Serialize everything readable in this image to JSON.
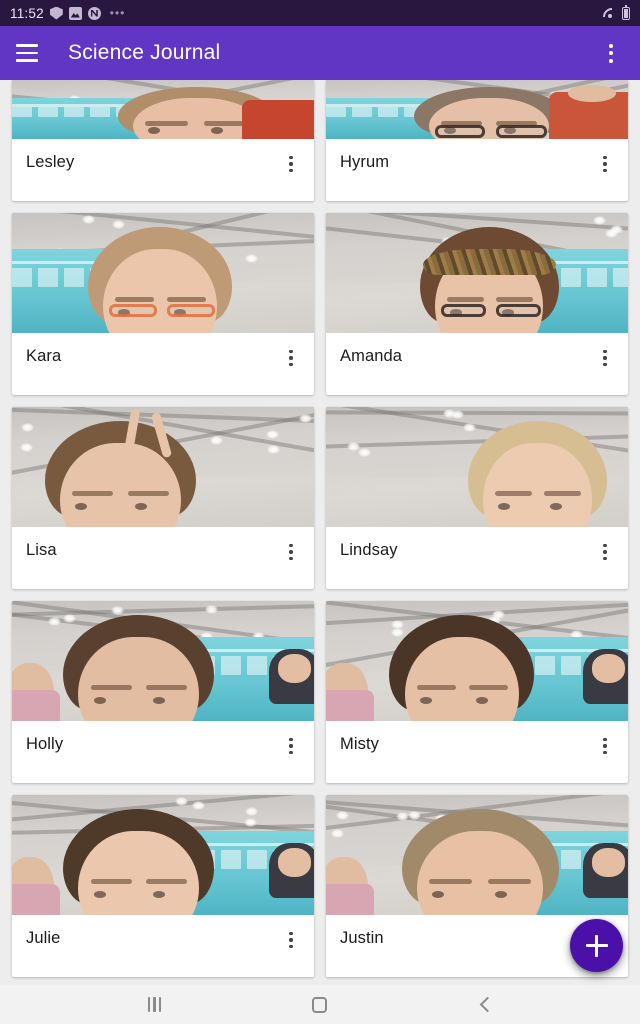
{
  "status_bar": {
    "time": "11:52",
    "left_icons": [
      "shield-icon",
      "photo-icon",
      "app-notification-icon"
    ],
    "overflow_indicator": "•••",
    "right_icons": [
      "wifi-icon",
      "battery-icon"
    ]
  },
  "app_bar": {
    "menu_icon": "hamburger-menu-icon",
    "title": "Science Journal",
    "overflow_icon": "more-vert-icon",
    "background_color": "#6236C4"
  },
  "experiments": [
    {
      "title": "Lesley",
      "clipped": true,
      "overflow_icon": "more-vert-icon"
    },
    {
      "title": "Hyrum",
      "clipped": true,
      "overflow_icon": "more-vert-icon"
    },
    {
      "title": "Kara",
      "clipped": false,
      "overflow_icon": "more-vert-icon"
    },
    {
      "title": "Amanda",
      "clipped": false,
      "overflow_icon": "more-vert-icon"
    },
    {
      "title": "Lisa",
      "clipped": false,
      "overflow_icon": "more-vert-icon"
    },
    {
      "title": "Lindsay",
      "clipped": false,
      "overflow_icon": "more-vert-icon"
    },
    {
      "title": "Holly",
      "clipped": false,
      "overflow_icon": "more-vert-icon"
    },
    {
      "title": "Misty",
      "clipped": false,
      "overflow_icon": "more-vert-icon"
    },
    {
      "title": "Julie",
      "clipped": false,
      "overflow_icon": "more-vert-icon"
    },
    {
      "title": "Justin",
      "clipped": false,
      "overflow_icon": "more-vert-icon"
    }
  ],
  "fab": {
    "icon": "plus-icon",
    "label": "+",
    "color": "#4A10A8"
  },
  "nav_bar": {
    "recents_icon": "recents-icon",
    "home_icon": "home-icon",
    "back_icon": "back-icon",
    "background_color": "#F2F2F2"
  },
  "colors": {
    "accent": "#6236C4",
    "fab": "#4A10A8",
    "page_background": "#EDEDED",
    "card_background": "#FFFFFF",
    "status_bar": "#2A1740"
  }
}
